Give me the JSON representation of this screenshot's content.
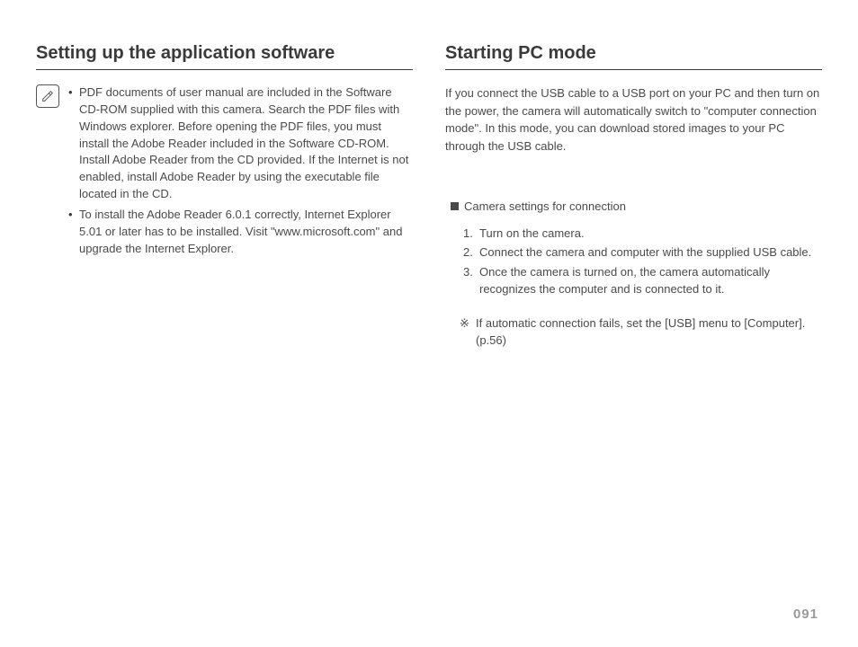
{
  "left": {
    "heading": "Setting up the application software",
    "bullets": [
      "PDF documents of user manual are included in the Software CD-ROM supplied with this camera. Search the PDF files with Windows explorer. Before opening the PDF files, you must install the Adobe Reader included in the Software CD-ROM. Install Adobe Reader from the CD provided. If the Internet is not enabled, install Adobe Reader by using the executable file located in the CD.",
      "To install the Adobe Reader 6.0.1 correctly, Internet Explorer 5.01 or later has to be installed. Visit \"www.microsoft.com\" and upgrade the Internet Explorer."
    ]
  },
  "right": {
    "heading": "Starting PC mode",
    "intro": "If you connect the USB cable to a USB port on your PC and then turn on the power, the camera will automatically switch to \"computer connection mode\". In this mode, you can download stored images to your PC through the USB cable.",
    "sub_heading": "Camera settings for connection",
    "steps": [
      "Turn on the camera.",
      "Connect the camera and computer with the supplied USB cable.",
      "Once the camera is turned on, the camera automatically recognizes the computer and is connected to it."
    ],
    "note_symbol": "※",
    "note": "If automatic connection fails, set the [USB] menu to [Computer]. (p.56)"
  },
  "page_number": "091"
}
